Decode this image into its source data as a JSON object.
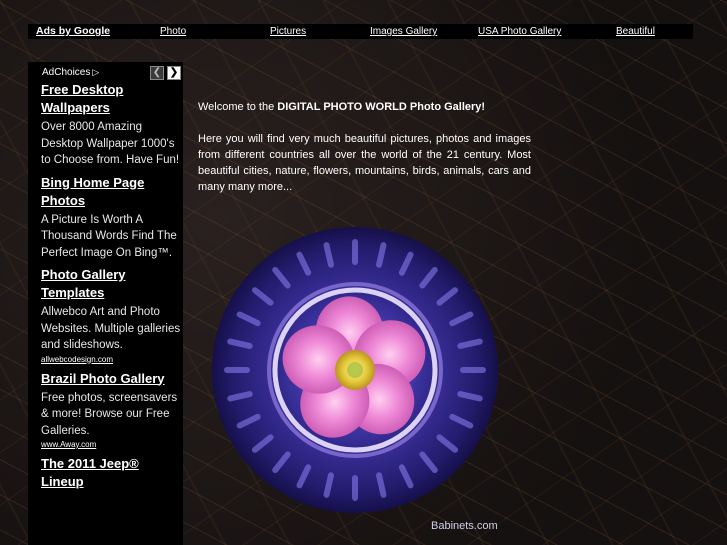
{
  "topnav": {
    "ads_by_google": "Ads by Google",
    "links": [
      "Photo",
      "Pictures",
      "Images Gallery",
      "USA Photo Gallery",
      "Beautiful"
    ]
  },
  "adcol": {
    "adchoices": "AdChoices",
    "prev_icon": "chevron-left-icon",
    "next_icon": "chevron-right-icon",
    "ads": [
      {
        "title": "Free Desktop Wallpapers",
        "desc": "Over 8000 Amazing Desktop Wallpaper 1000's to Choose from. Have Fun!",
        "url": ""
      },
      {
        "title": "Bing Home Page Photos",
        "desc": "A Picture Is Worth A Thousand Words Find The Perfect Image On Bing™.",
        "url": ""
      },
      {
        "title": "Photo Gallery Templates",
        "desc": "Allwebco Art and Photo Websites. Multiple galleries and slideshows.",
        "url": "allwebcodesign.com"
      },
      {
        "title": "Brazil Photo Gallery",
        "desc": "Free photos, screensavers & more! Browse our Free Galleries.",
        "url": "www.Away.com"
      },
      {
        "title": "The 2011 Jeep® Lineup",
        "desc": "",
        "url": ""
      }
    ]
  },
  "main": {
    "welcome_prefix": "Welcome to the ",
    "welcome_bold": "DIGITAL PHOTO WORLD Photo Gallery!",
    "intro": "Here you will find very much beautiful pictures, photos and images from different countries all over the world of the 21 century. Most beautiful cities, nature, flowers, mountains, birds, animals, cars and many many more...",
    "image_credit": "Babinets.com"
  },
  "colors": {
    "background": "#1a1513",
    "bar": "#000000",
    "text": "#ffffff",
    "flower_petal": "#e872c8",
    "flower_center": "#e8d040",
    "ring_glow": "#b9a0ff",
    "plate": "#3a2f9a"
  }
}
